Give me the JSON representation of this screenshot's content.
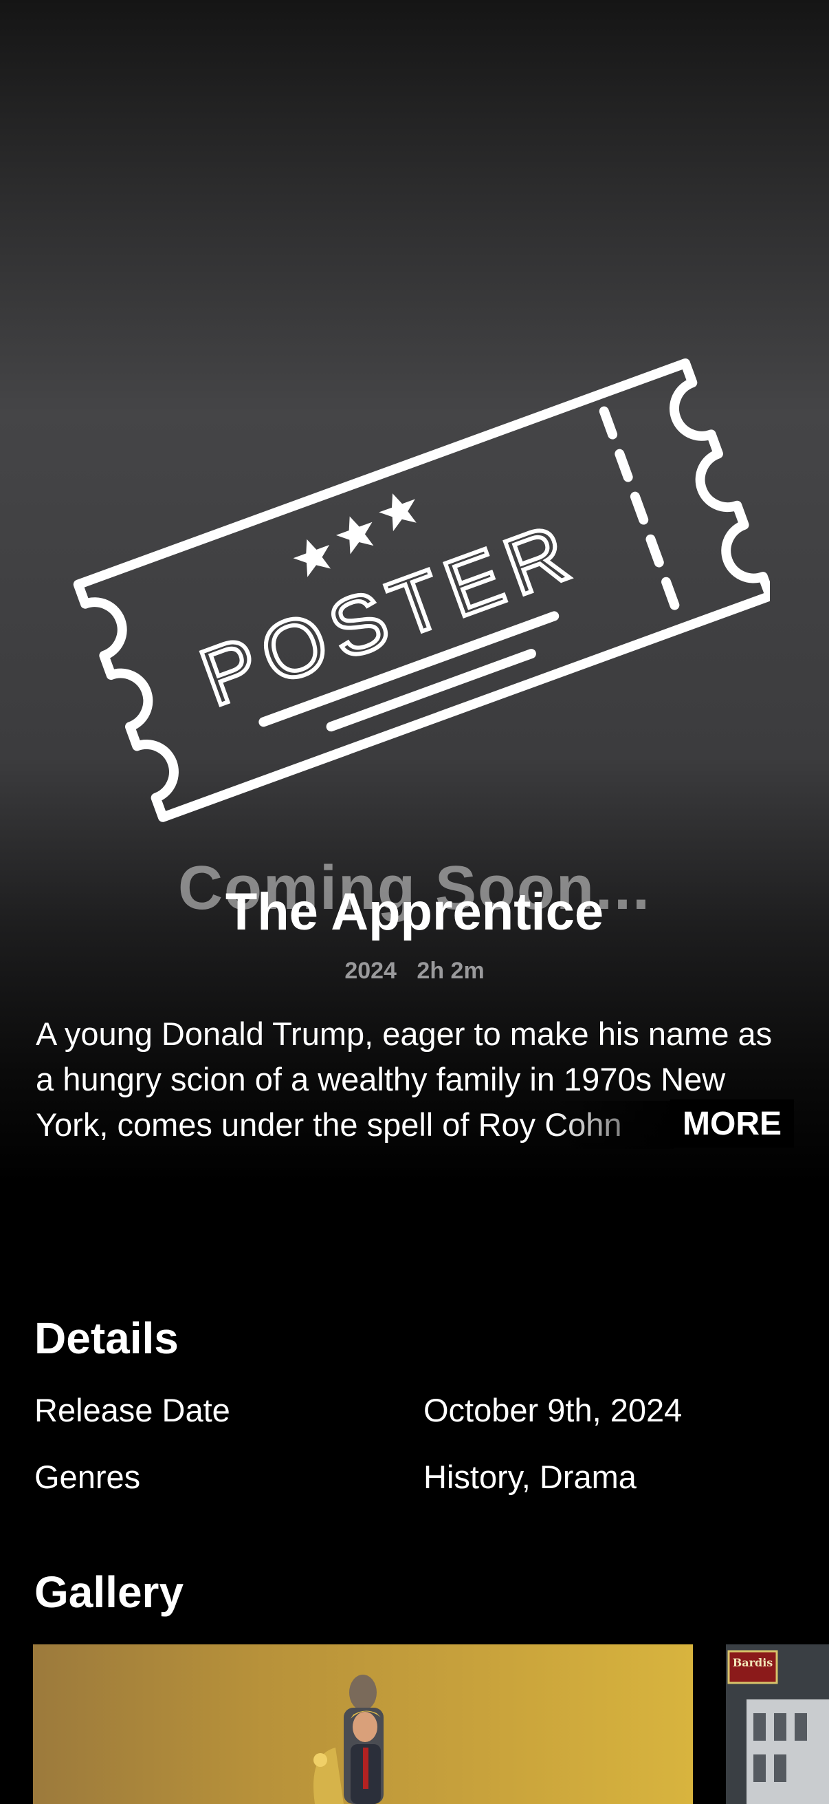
{
  "poster": {
    "placeholder_text": "POSTER",
    "coming_soon": "Coming Soon..."
  },
  "movie": {
    "title": "The Apprentice",
    "year": "2024",
    "runtime": "2h 2m",
    "synopsis": "A young Donald Trump, eager to make his name as a hungry scion of a wealthy family in 1970s New York, comes under the spell of Roy Cohn",
    "more_label": "MORE"
  },
  "details": {
    "heading": "Details",
    "rows": [
      {
        "label": "Release Date",
        "value": "October 9th, 2024"
      },
      {
        "label": "Genres",
        "value": "History, Drama"
      }
    ]
  },
  "gallery": {
    "heading": "Gallery",
    "images": [
      {
        "name": "gallery-image-1"
      },
      {
        "name": "gallery-image-2",
        "sign_text": "Bardis"
      }
    ]
  }
}
